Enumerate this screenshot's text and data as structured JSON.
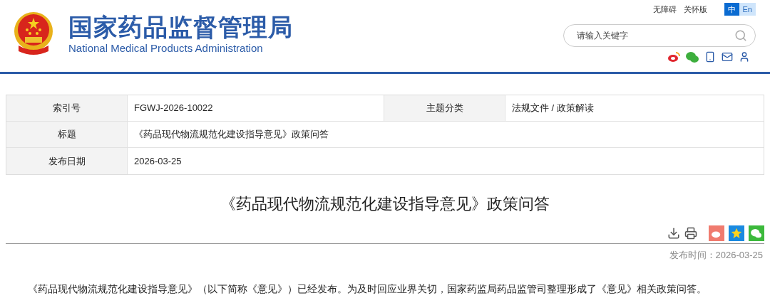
{
  "header": {
    "title": "国家药品监督管理局",
    "subtitle": "National Medical Products Administration",
    "top_links": [
      "无障碍",
      "关怀版"
    ],
    "languages": [
      {
        "label": "中",
        "selected": true
      },
      {
        "label": "En",
        "selected": false
      }
    ],
    "search": {
      "placeholder": "请输入关键字"
    }
  },
  "info_table": {
    "rows": [
      {
        "cells": [
          {
            "kind": "label",
            "text": "索引号"
          },
          {
            "kind": "value",
            "text": "FGWJ-2026-10022"
          },
          {
            "kind": "label",
            "text": "主题分类"
          },
          {
            "kind": "value",
            "text": "法规文件 / 政策解读"
          }
        ]
      },
      {
        "cells": [
          {
            "kind": "label",
            "text": "标题"
          },
          {
            "kind": "value",
            "text": "《药品现代物流规范化建设指导意见》政策问答"
          }
        ]
      },
      {
        "cells": [
          {
            "kind": "label",
            "text": "发布日期"
          },
          {
            "kind": "value",
            "text": "2026-03-25"
          }
        ]
      }
    ]
  },
  "article": {
    "title": "《药品现代物流规范化建设指导意见》政策问答",
    "publish_time": "发布时间：2026-03-25",
    "paragraph": "《药品现代物流规范化建设指导意见》（以下简称《意见》）已经发布。为及时回应业界关切，国家药监局药品监管司整理形成了《意见》相关政策问答。"
  }
}
